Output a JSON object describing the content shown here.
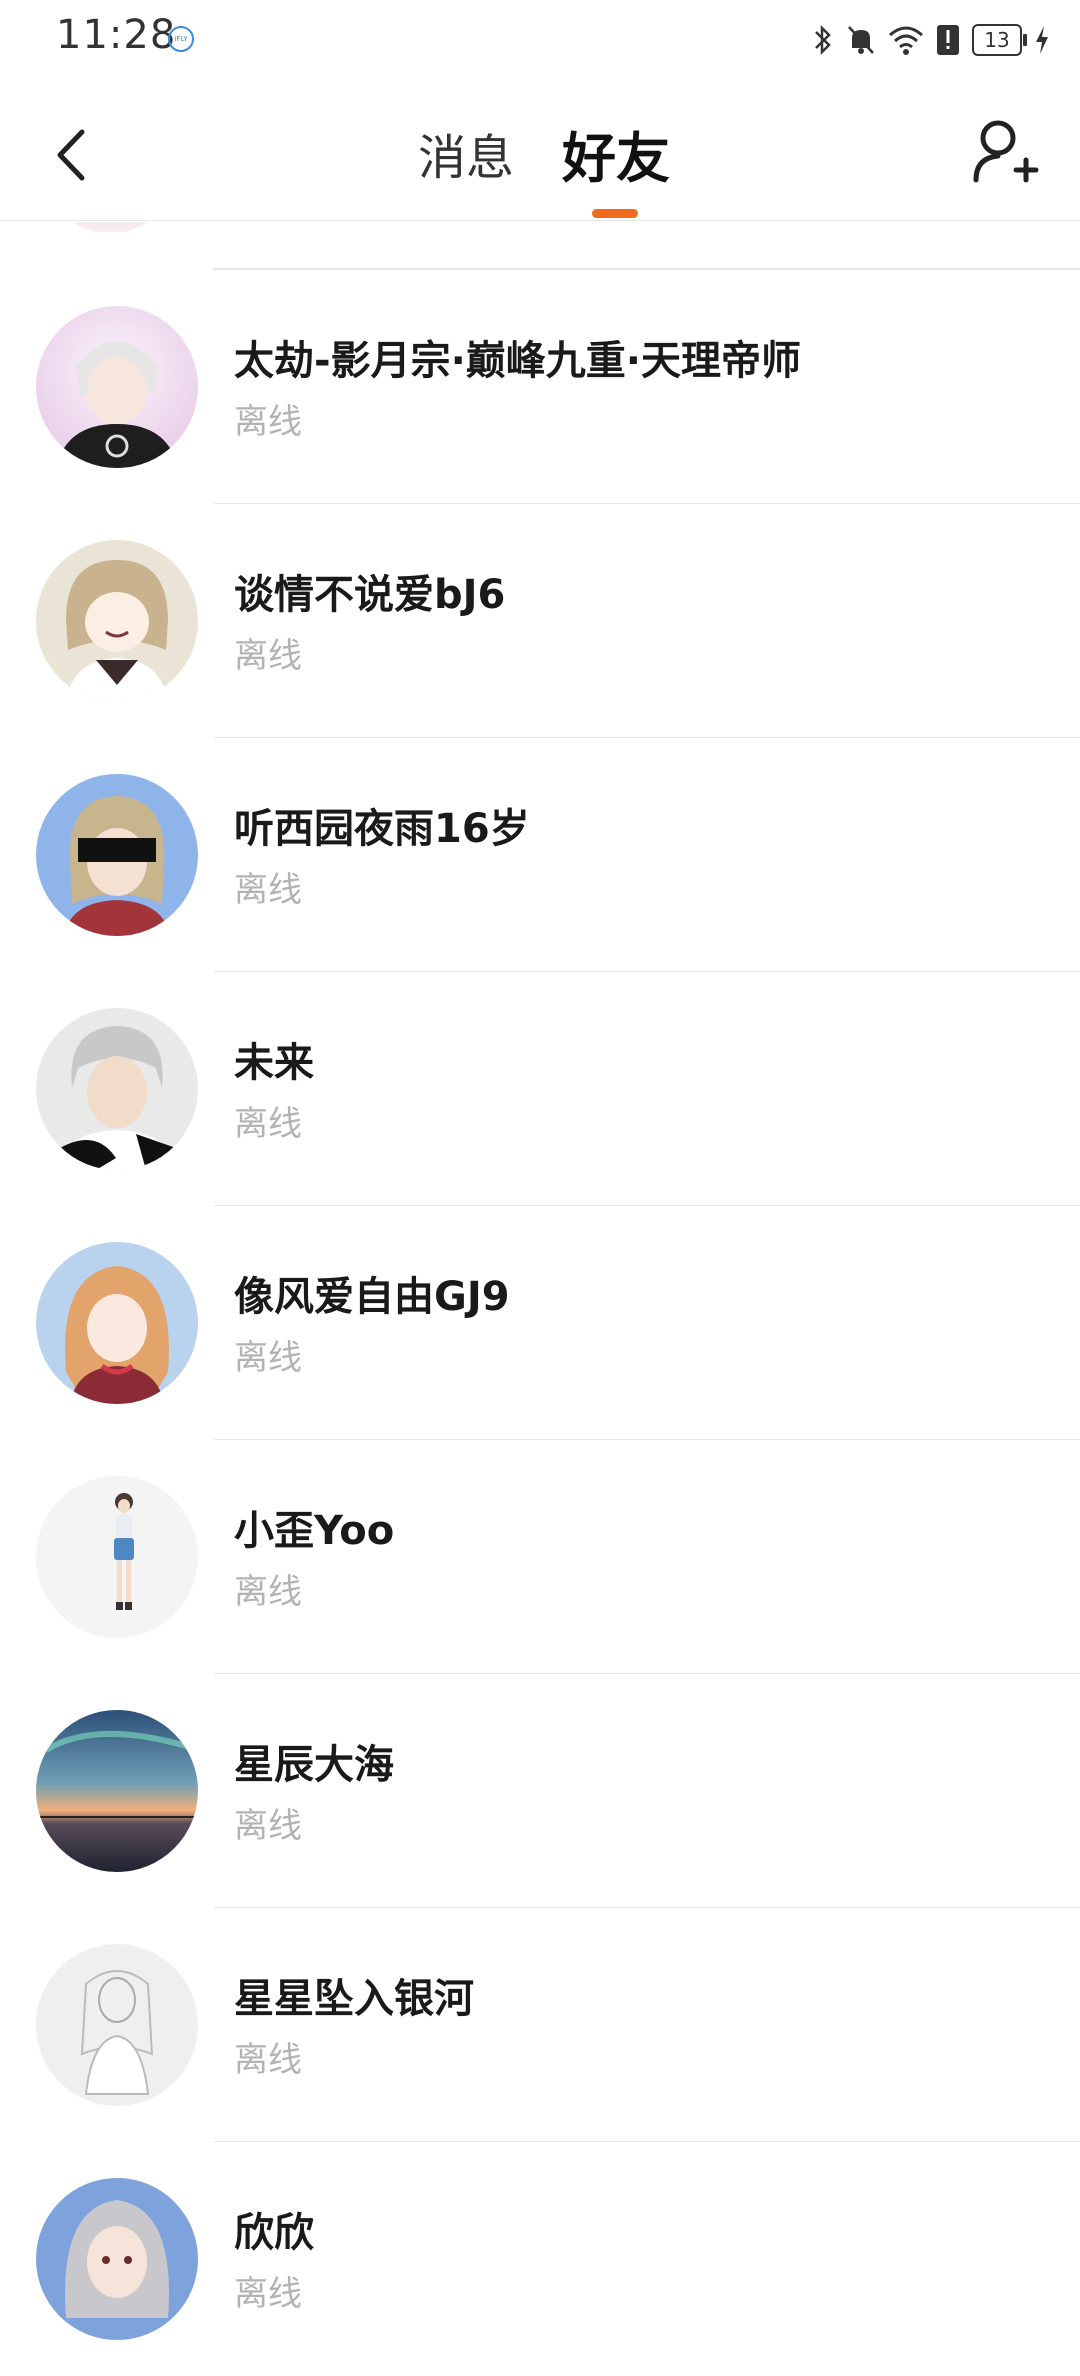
{
  "status_bar": {
    "time": "11:28",
    "battery": "13"
  },
  "header": {
    "tabs": [
      {
        "label": "消息",
        "active": false
      },
      {
        "label": "好友",
        "active": true
      }
    ],
    "accent_color": "#f26b1d"
  },
  "friends": [
    {
      "name": "太劫-影月宗·巅峰九重·天理帝师",
      "status": "离线"
    },
    {
      "name": "谈情不说爱bJ6",
      "status": "离线"
    },
    {
      "name": "听西园夜雨16岁",
      "status": "离线"
    },
    {
      "name": "未来",
      "status": "离线"
    },
    {
      "name": "像风爱自由GJ9",
      "status": "离线"
    },
    {
      "name": "小歪Yoo",
      "status": "离线"
    },
    {
      "name": "星辰大海",
      "status": "离线"
    },
    {
      "name": "星星坠入银河",
      "status": "离线"
    },
    {
      "name": "欣欣",
      "status": "离线"
    }
  ]
}
